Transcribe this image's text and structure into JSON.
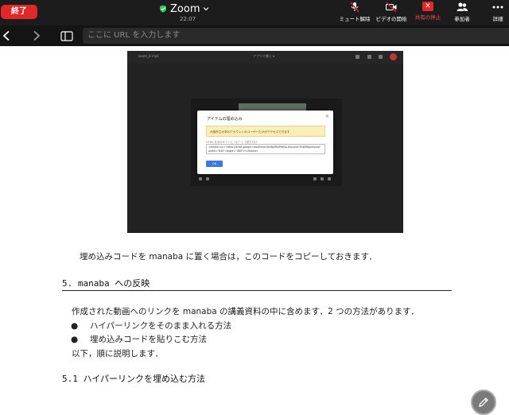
{
  "zoom": {
    "end_label": "終了",
    "title": "Zoom",
    "time": "22:07",
    "toolbar": {
      "mute": "ミュート解除",
      "video": "ビデオの開始",
      "share": "共有の停止",
      "participants": "参加者",
      "more": "詳細"
    },
    "colors": {
      "end": "#e02828",
      "share": "#e02828",
      "shield": "#34c759"
    }
  },
  "browser": {
    "url_placeholder": "ここに URL を入力します"
  },
  "embed": {
    "header_title": "zoom_0.mp4",
    "header_mid": "アプリで開く ▾",
    "dialog_title": "アイテムの埋め込み",
    "dialog_warning": "大阪市立大学のアカウントのユーザーだけがアクセスできます",
    "code_label": "HTML を次のサイトにコピーして貼り付け",
    "code_text": "<iframe src=\"https://drive.google.com/file/d/1NX8jdRUiPa6nA-tEtpvce/OFqE8N/preview\" width=\"640\" height=\"480\"></iframe>",
    "ok_label": "OK"
  },
  "doc": {
    "p_copy": "埋め込みコードを manaba に置く場合は，このコードをコピーしておきます．",
    "h_sec5": "5. manaba への反映",
    "p_intro": "作成された動画へのリンクを manaba の講義資料の中に含めます．2 つの方法があります．",
    "bullets": [
      "ハイパーリンクをそのまま入れる方法",
      "埋め込みコードを貼りこむ方法"
    ],
    "bullet_char": "●",
    "p_order": "以下，順に説明します．",
    "h_sec51": "5.1 ハイパーリンクを埋め込む方法"
  }
}
